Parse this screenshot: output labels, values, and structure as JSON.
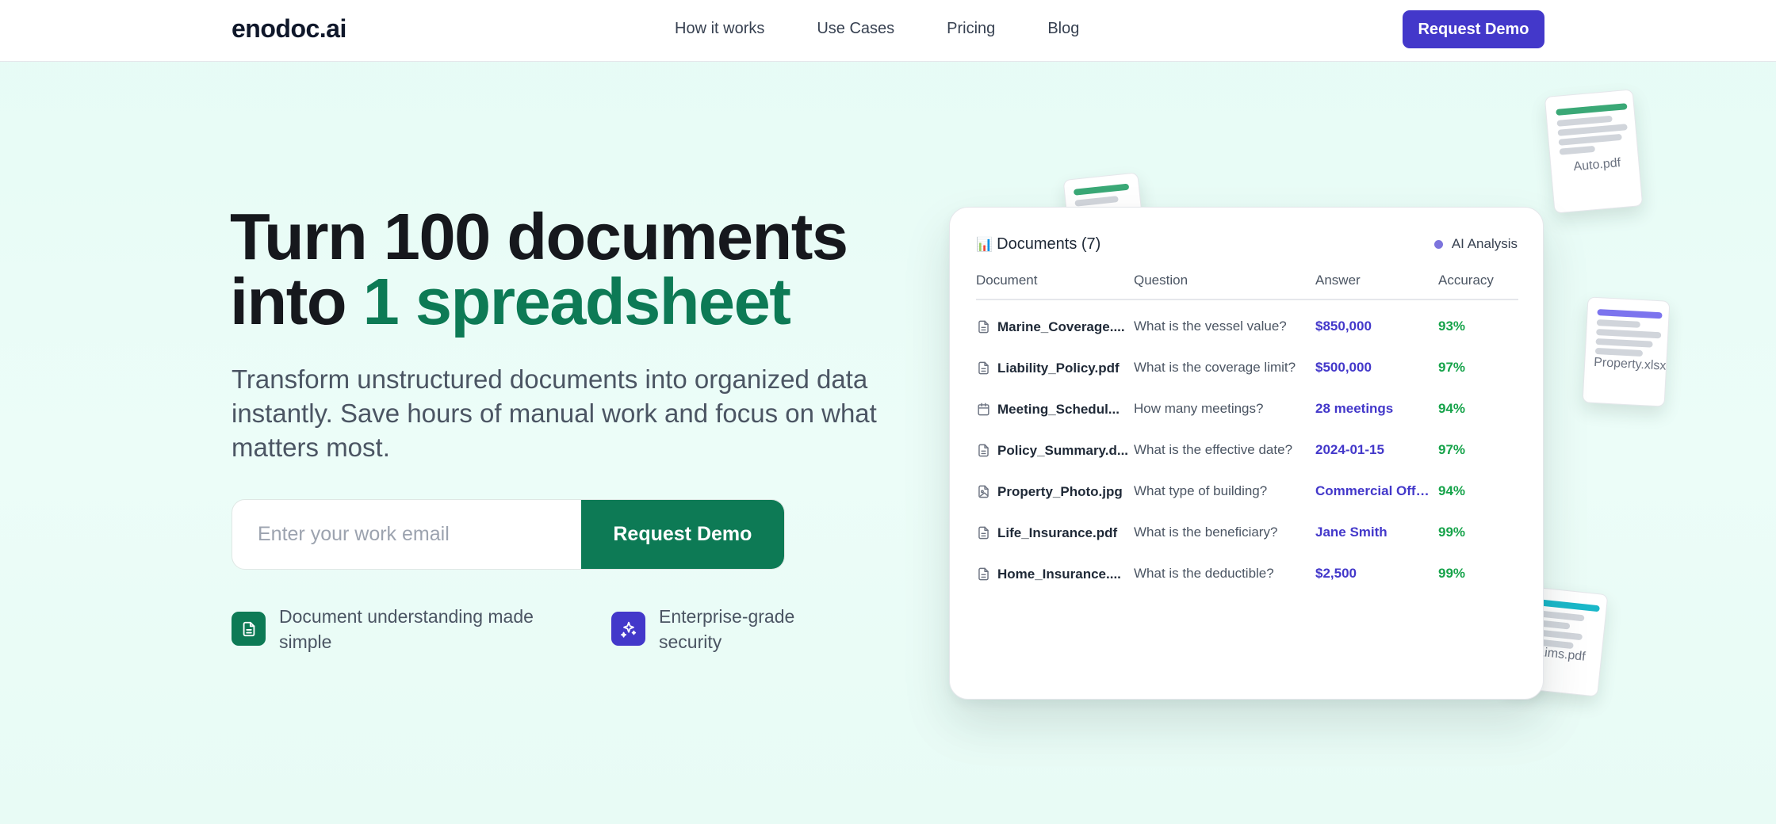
{
  "nav": {
    "logo": "enodoc.ai",
    "links": [
      "How it works",
      "Use Cases",
      "Pricing",
      "Blog"
    ],
    "cta": "Request Demo"
  },
  "hero": {
    "title_line1": "Turn 100 documents",
    "title_line2_prefix": "into ",
    "title_line2_accent": "1 spreadsheet",
    "subtitle": "Transform unstructured documents into organized data instantly. Save hours of manual work and focus on what matters most.",
    "email_placeholder": "Enter your work email",
    "email_button": "Request Demo",
    "features": [
      {
        "text": "Document understanding made simple",
        "icon": "document-icon",
        "color": "#0d7a55"
      },
      {
        "text": "Enterprise-grade security",
        "icon": "sparkles-icon",
        "color": "#4338ca"
      }
    ]
  },
  "card": {
    "title_icon": "📊",
    "title": "Documents (7)",
    "badge": "AI Analysis",
    "columns": [
      "Document",
      "Question",
      "Answer",
      "Accuracy"
    ],
    "rows": [
      {
        "doc": "Marine_Coverage....",
        "icon": "file-icon",
        "question": "What is the vessel value?",
        "answer": "$850,000",
        "accuracy": "93%"
      },
      {
        "doc": "Liability_Policy.pdf",
        "icon": "file-icon",
        "question": "What is the coverage limit?",
        "answer": "$500,000",
        "accuracy": "97%"
      },
      {
        "doc": "Meeting_Schedul...",
        "icon": "calendar-icon",
        "question": "How many meetings?",
        "answer": "28 meetings",
        "accuracy": "94%"
      },
      {
        "doc": "Policy_Summary.d...",
        "icon": "file-icon",
        "question": "What is the effective date?",
        "answer": "2024-01-15",
        "accuracy": "97%"
      },
      {
        "doc": "Property_Photo.jpg",
        "icon": "image-file-icon",
        "question": "What type of building?",
        "answer": "Commercial Offi...",
        "accuracy": "94%"
      },
      {
        "doc": "Life_Insurance.pdf",
        "icon": "file-icon",
        "question": "What is the beneficiary?",
        "answer": "Jane Smith",
        "accuracy": "99%"
      },
      {
        "doc": "Home_Insurance....",
        "icon": "file-icon",
        "question": "What is the deductible?",
        "answer": "$2,500",
        "accuracy": "99%"
      }
    ]
  },
  "floating_docs": [
    {
      "label": "Auto.pdf",
      "accent": "#3aa876"
    },
    {
      "label": "Property.xlsx",
      "accent": "#7c74ee"
    },
    {
      "label": "aims.pdf",
      "accent": "#1ab8c9"
    },
    {
      "label": "",
      "accent": "#3aa876"
    }
  ],
  "colors": {
    "brand_green": "#0d7a55",
    "brand_indigo": "#4338ca",
    "accuracy_green": "#16a34a"
  }
}
